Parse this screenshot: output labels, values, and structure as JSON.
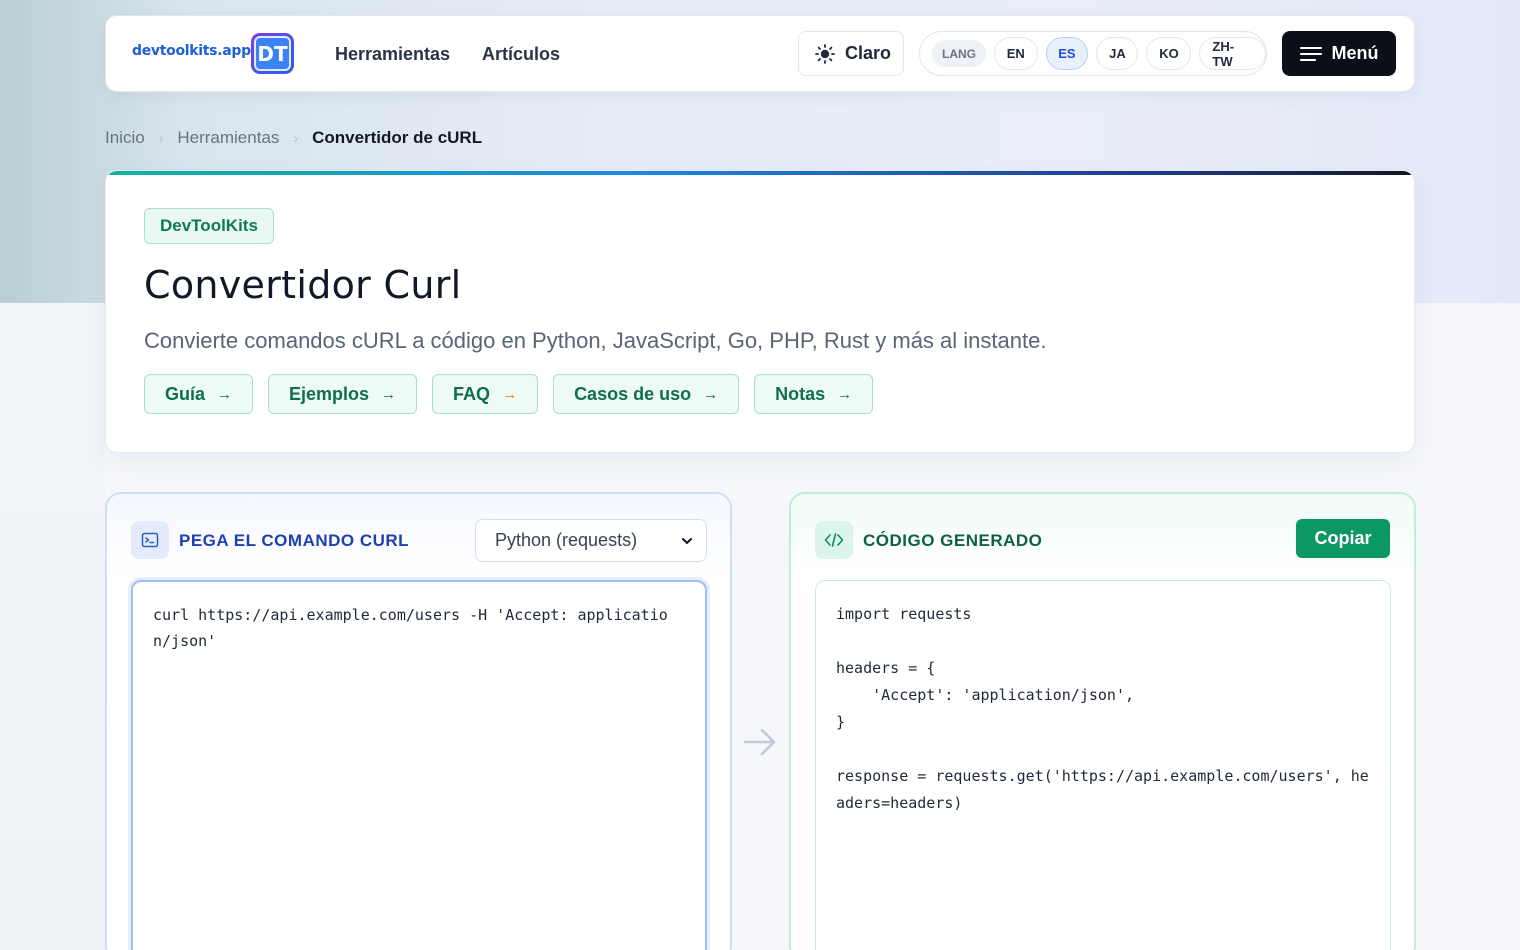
{
  "header": {
    "logo_text": "devtoolkits.app",
    "logo_mark": "DT",
    "nav": [
      "Herramientas",
      "Artículos"
    ],
    "theme_label": "Claro",
    "theme_icon": "sun-icon",
    "lang_label": "LANG",
    "languages": [
      "EN",
      "ES",
      "JA",
      "KO",
      "ZH-TW"
    ],
    "active_language": "ES",
    "menu_label": "Menú",
    "menu_icon": "hamburger-icon"
  },
  "breadcrumb": {
    "items": [
      "Inicio",
      "Herramientas"
    ],
    "current": "Convertidor de cURL",
    "separator": "›"
  },
  "hero": {
    "badge": "DevToolKits",
    "title": "Convertidor Curl",
    "subtitle": "Convierte comandos cURL a código en Python, JavaScript, Go, PHP, Rust y más al instante.",
    "pills": [
      "Guía",
      "Ejemplos",
      "FAQ",
      "Casos de uso",
      "Notas"
    ],
    "pill_arrow": "→"
  },
  "input_panel": {
    "title": "PEGA EL COMANDO CURL",
    "icon": "terminal-icon",
    "target_language": "Python (requests)",
    "command": "curl https://api.example.com/users -H 'Accept: application/json'"
  },
  "output_panel": {
    "title": "CÓDIGO GENERADO",
    "icon": "code-icon",
    "copy_label": "Copiar",
    "code": "import requests\n\nheaders = {\n    'Accept': 'application/json',\n}\n\nresponse = requests.get('https://api.example.com/users', headers=headers)"
  },
  "colors": {
    "accent_blue": "#1e40af",
    "accent_green": "#0c9865",
    "menu_bg": "#0b0f17"
  }
}
